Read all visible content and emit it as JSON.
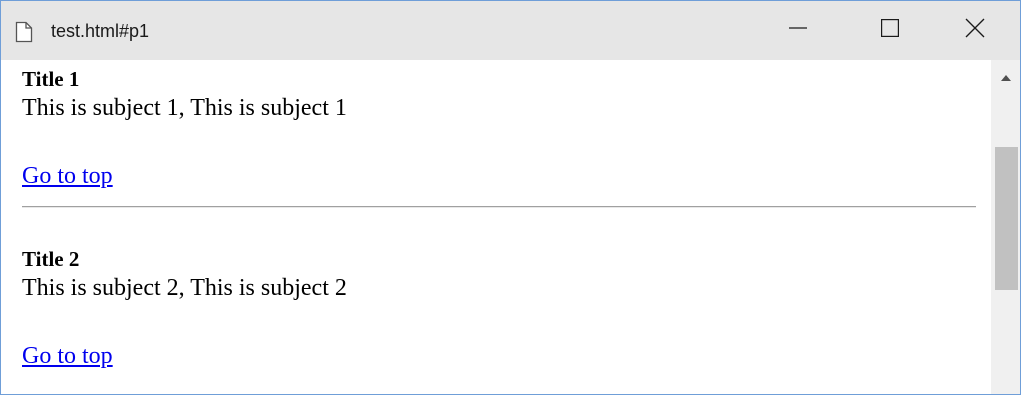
{
  "window": {
    "title": "test.html#p1",
    "minimize_glyph": "—",
    "maximize_glyph": "☐",
    "close_glyph": "✕"
  },
  "page": {
    "sections": [
      {
        "title": "Title 1",
        "body": "This is subject 1, This is subject 1",
        "link": "Go to top"
      },
      {
        "title": "Title 2",
        "body": "This is subject 2, This is subject 2",
        "link": "Go to top"
      }
    ]
  },
  "colors": {
    "titlebar_bg": "#e6e6e6",
    "link": "#0000ee",
    "scroll_track": "#f0f0f0",
    "scroll_thumb": "#c1c1c1"
  },
  "icons": {
    "document": "document-icon",
    "minimize": "minimize-icon",
    "maximize": "maximize-icon",
    "close": "close-icon",
    "scroll_up": "scroll-up-arrow-icon"
  }
}
